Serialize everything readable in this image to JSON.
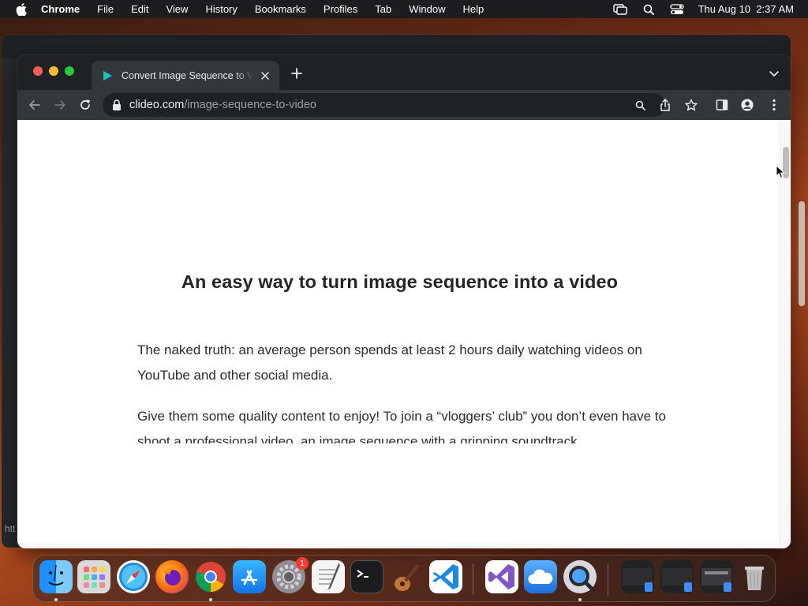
{
  "menubar": {
    "app": "Chrome",
    "items": [
      "File",
      "Edit",
      "View",
      "History",
      "Bookmarks",
      "Profiles",
      "Tab",
      "Window",
      "Help"
    ],
    "clock": "Thu Aug 10  2:37 AM"
  },
  "bgwindow": {
    "edge_text": "htt"
  },
  "browser": {
    "tab_title": "Convert Image Sequence to Video",
    "url_domain": "clideo.com",
    "url_path": "/image-sequence-to-video"
  },
  "page": {
    "heading": "An easy way to turn image sequence into a video",
    "paragraph1": "The naked truth: an average person spends at least 2 hours daily watching videos on YouTube and other social media.",
    "paragraph2": "Give them some quality content to enjoy! To join a “vloggers’ club” you don’t even have to shoot a professional video, an image sequence with a gripping soundtrack"
  },
  "dock": {
    "settings_badge": "1",
    "apps": [
      "finder-icon",
      "launchpad-icon",
      "safari-icon",
      "firefox-icon",
      "chrome-icon",
      "app-store-icon",
      "system-settings-icon",
      "textedit-icon",
      "terminal-icon",
      "instruments-icon",
      "vscode-icon",
      "visual-studio-icon",
      "icloud-icon",
      "quicktime-icon",
      "window-thumb-icon",
      "window-thumb-icon",
      "window-thumb-icon",
      "trash-icon"
    ]
  },
  "colors": {
    "tab_active": "#35363a",
    "frame": "#202124",
    "accent_red": "#ff5f57",
    "accent_yellow": "#febc2e",
    "accent_green": "#28c840"
  }
}
